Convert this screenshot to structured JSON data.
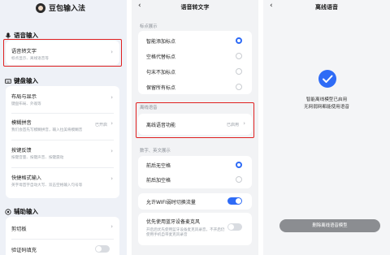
{
  "panel1": {
    "title": "豆包输入法",
    "voice_section": "语音输入",
    "voice_item": {
      "title": "语音转文字",
      "sub": "标点显示、离线语音等"
    },
    "keyboard_section": "键盘输入",
    "keyboard_items": [
      {
        "title": "布局与显示",
        "sub": "键盘布局、外观等"
      },
      {
        "title": "模糊拼音",
        "sub": "我们会首先写模糊拼音，输入拉美将模糊音",
        "tag": "已开启"
      },
      {
        "title": "按键反馈",
        "sub": "按键音量、按键声音、按键震动"
      },
      {
        "title": "快捷格式输入",
        "sub": "英字母首字自动大写、双击空格输入句号等"
      }
    ],
    "aux_section": "辅助输入",
    "aux_items": [
      {
        "title": "剪切板"
      },
      {
        "title": "验证码填充"
      }
    ]
  },
  "panel2": {
    "title": "语音转文字",
    "punct_label": "标点展示",
    "punct_options": [
      {
        "label": "智能添加标点",
        "selected": true
      },
      {
        "label": "空格代替标点",
        "selected": false
      },
      {
        "label": "句末不加标点",
        "selected": false
      },
      {
        "label": "保留所有标点",
        "selected": false
      }
    ],
    "offline_label": "离线语音",
    "offline_item": {
      "title": "离线语音功能",
      "tag": "已启用"
    },
    "digits_label": "数字、英文展示",
    "digit_options": [
      {
        "label": "前后无空格",
        "selected": true
      },
      {
        "label": "前后加空格",
        "selected": false
      }
    ],
    "wifi_item": {
      "title": "允许WIFI弱时切换流量",
      "on": true
    },
    "bt_item": {
      "title": "优先使用蓝牙设备麦克风",
      "sub": "开启后优先使用蓝牙设备麦克风录音，不开启仍使用手机自带麦克风录音",
      "on": false
    }
  },
  "panel3": {
    "title": "离线语音",
    "status_line1": "智能离线模型已启用",
    "status_line2": "无网弱网都能使用语音",
    "delete_button": "删除离线语音模型"
  },
  "colors": {
    "accent": "#2e6bf6",
    "highlight": "#e02020"
  }
}
